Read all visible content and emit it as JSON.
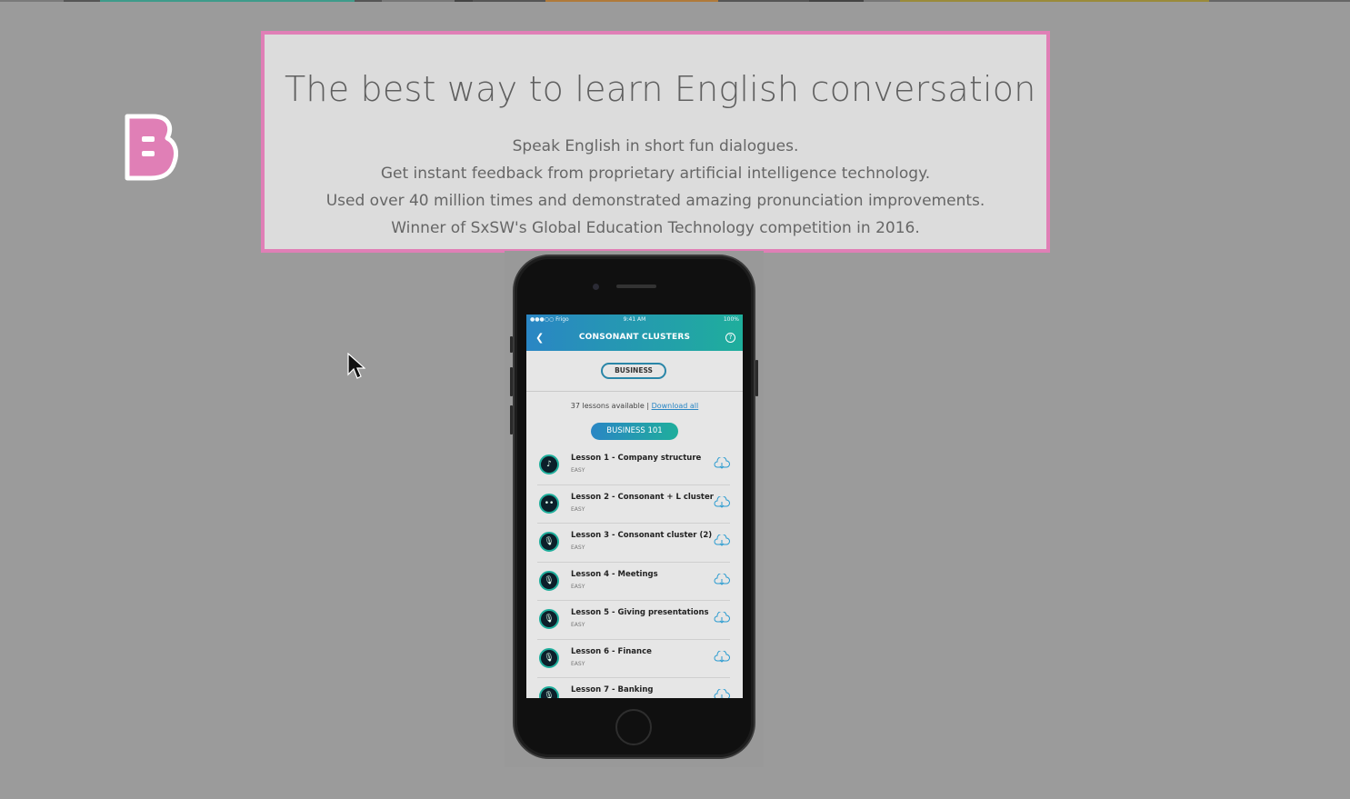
{
  "hero": {
    "title": "The best way to learn English conversation",
    "lines": [
      "Speak English in short fun dialogues.",
      "Get instant feedback from proprietary artificial intelligence technology.",
      "Used over 40 million times and demonstrated amazing pronunciation improvements.",
      "Winner of SxSW's Global Education Technology competition in 2016."
    ]
  },
  "logo": {
    "letter": "B",
    "color": "#e07fb6"
  },
  "colors": {
    "accent_border": "#e07fb6",
    "page_bg": "#9b9b9b",
    "card_bg": "#dcdcdc",
    "app_gradient_start": "#2a86c4",
    "app_gradient_end": "#1fae9c"
  },
  "app": {
    "status": {
      "carrier": "●●●○○ Frigo",
      "time": "9:41 AM",
      "battery": "100%"
    },
    "title": "CONSONANT CLUSTERS",
    "category_chip": "BUSINESS",
    "lessons_available": "37 lessons available | ",
    "download_all": "Download all",
    "course": "BUSINESS 101",
    "lessons": [
      {
        "title": "Lesson 1 - Company structure",
        "level": "EASY",
        "icon": "headphones-icon"
      },
      {
        "title": "Lesson 2 - Consonant + L cluster",
        "level": "EASY",
        "icon": "chat-icon"
      },
      {
        "title": "Lesson 3 - Consonant cluster (2)",
        "level": "EASY",
        "icon": "microphone-icon"
      },
      {
        "title": "Lesson 4 - Meetings",
        "level": "EASY",
        "icon": "microphone-icon"
      },
      {
        "title": "Lesson 5 - Giving presentations",
        "level": "EASY",
        "icon": "microphone-icon"
      },
      {
        "title": "Lesson 6 - Finance",
        "level": "EASY",
        "icon": "microphone-icon"
      },
      {
        "title": "Lesson 7 - Banking",
        "level": "",
        "icon": "microphone-icon"
      }
    ]
  }
}
